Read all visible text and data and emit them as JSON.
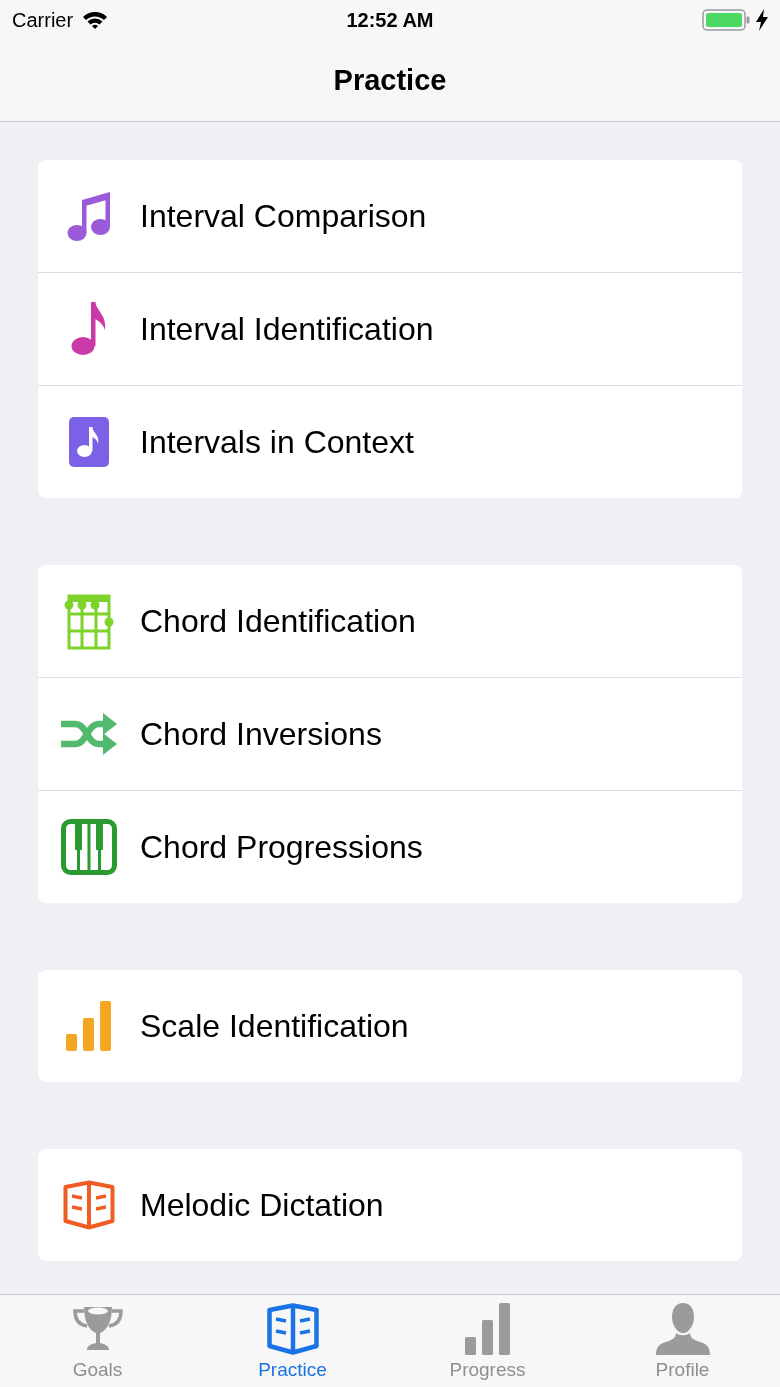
{
  "status_bar": {
    "carrier": "Carrier",
    "time": "12:52 AM"
  },
  "nav_bar": {
    "title": "Practice"
  },
  "sections": [
    {
      "items": [
        {
          "kind": "beamed-notes",
          "label": "Interval Comparison"
        },
        {
          "kind": "eighth-note",
          "label": "Interval Identification"
        },
        {
          "kind": "note-tile",
          "label": "Intervals in Context"
        }
      ]
    },
    {
      "items": [
        {
          "kind": "chord-chart",
          "label": "Chord Identification"
        },
        {
          "kind": "shuffle",
          "label": "Chord Inversions"
        },
        {
          "kind": "piano",
          "label": "Chord Progressions"
        }
      ]
    },
    {
      "items": [
        {
          "kind": "bars",
          "label": "Scale Identification"
        }
      ]
    },
    {
      "items": [
        {
          "kind": "book",
          "label": "Melodic Dictation"
        }
      ]
    }
  ],
  "tab_bar": [
    {
      "kind": "trophy",
      "label": "Goals",
      "selected": false
    },
    {
      "kind": "book",
      "label": "Practice",
      "selected": true
    },
    {
      "kind": "bars",
      "label": "Progress",
      "selected": false
    },
    {
      "kind": "person",
      "label": "Profile",
      "selected": false
    }
  ]
}
